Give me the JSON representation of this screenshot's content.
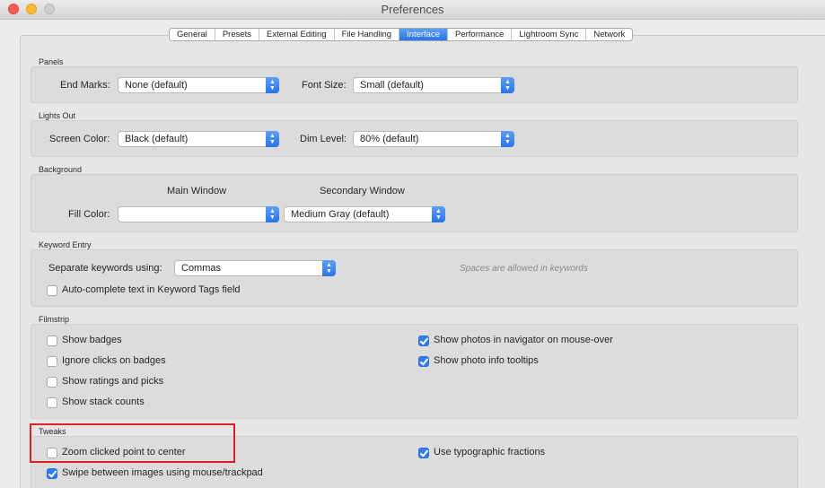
{
  "window": {
    "title": "Preferences"
  },
  "tabs": [
    {
      "label": "General"
    },
    {
      "label": "Presets"
    },
    {
      "label": "External Editing"
    },
    {
      "label": "File Handling"
    },
    {
      "label": "Interface",
      "active": true
    },
    {
      "label": "Performance"
    },
    {
      "label": "Lightroom Sync"
    },
    {
      "label": "Network"
    }
  ],
  "panels": {
    "title": "Panels",
    "end_marks_label": "End Marks:",
    "end_marks_value": "None (default)",
    "font_size_label": "Font Size:",
    "font_size_value": "Small (default)"
  },
  "lights_out": {
    "title": "Lights Out",
    "screen_color_label": "Screen Color:",
    "screen_color_value": "Black (default)",
    "dim_level_label": "Dim Level:",
    "dim_level_value": "80% (default)"
  },
  "background": {
    "title": "Background",
    "main_window_label": "Main Window",
    "secondary_window_label": "Secondary Window",
    "fill_color_label": "Fill Color:",
    "main_fill_value": "",
    "secondary_fill_value": "Medium Gray (default)"
  },
  "keyword_entry": {
    "title": "Keyword Entry",
    "separate_label": "Separate keywords using:",
    "separate_value": "Commas",
    "hint": "Spaces are allowed in keywords",
    "autocomplete_label": "Auto-complete text in Keyword Tags field",
    "autocomplete_checked": false
  },
  "filmstrip": {
    "title": "Filmstrip",
    "show_badges_label": "Show badges",
    "show_badges_checked": false,
    "ignore_clicks_label": "Ignore clicks on badges",
    "ignore_clicks_checked": false,
    "show_ratings_label": "Show ratings and picks",
    "show_ratings_checked": false,
    "show_stack_label": "Show stack counts",
    "show_stack_checked": false,
    "navigator_label": "Show photos in navigator on mouse-over",
    "navigator_checked": true,
    "tooltips_label": "Show photo info tooltips",
    "tooltips_checked": true
  },
  "tweaks": {
    "title": "Tweaks",
    "zoom_label": "Zoom clicked point to center",
    "zoom_checked": false,
    "swipe_label": "Swipe between images using mouse/trackpad",
    "swipe_checked": true,
    "fractions_label": "Use typographic fractions",
    "fractions_checked": true
  },
  "colors": {
    "accent": "#2f7cf0",
    "highlight_box": "#e02020"
  }
}
